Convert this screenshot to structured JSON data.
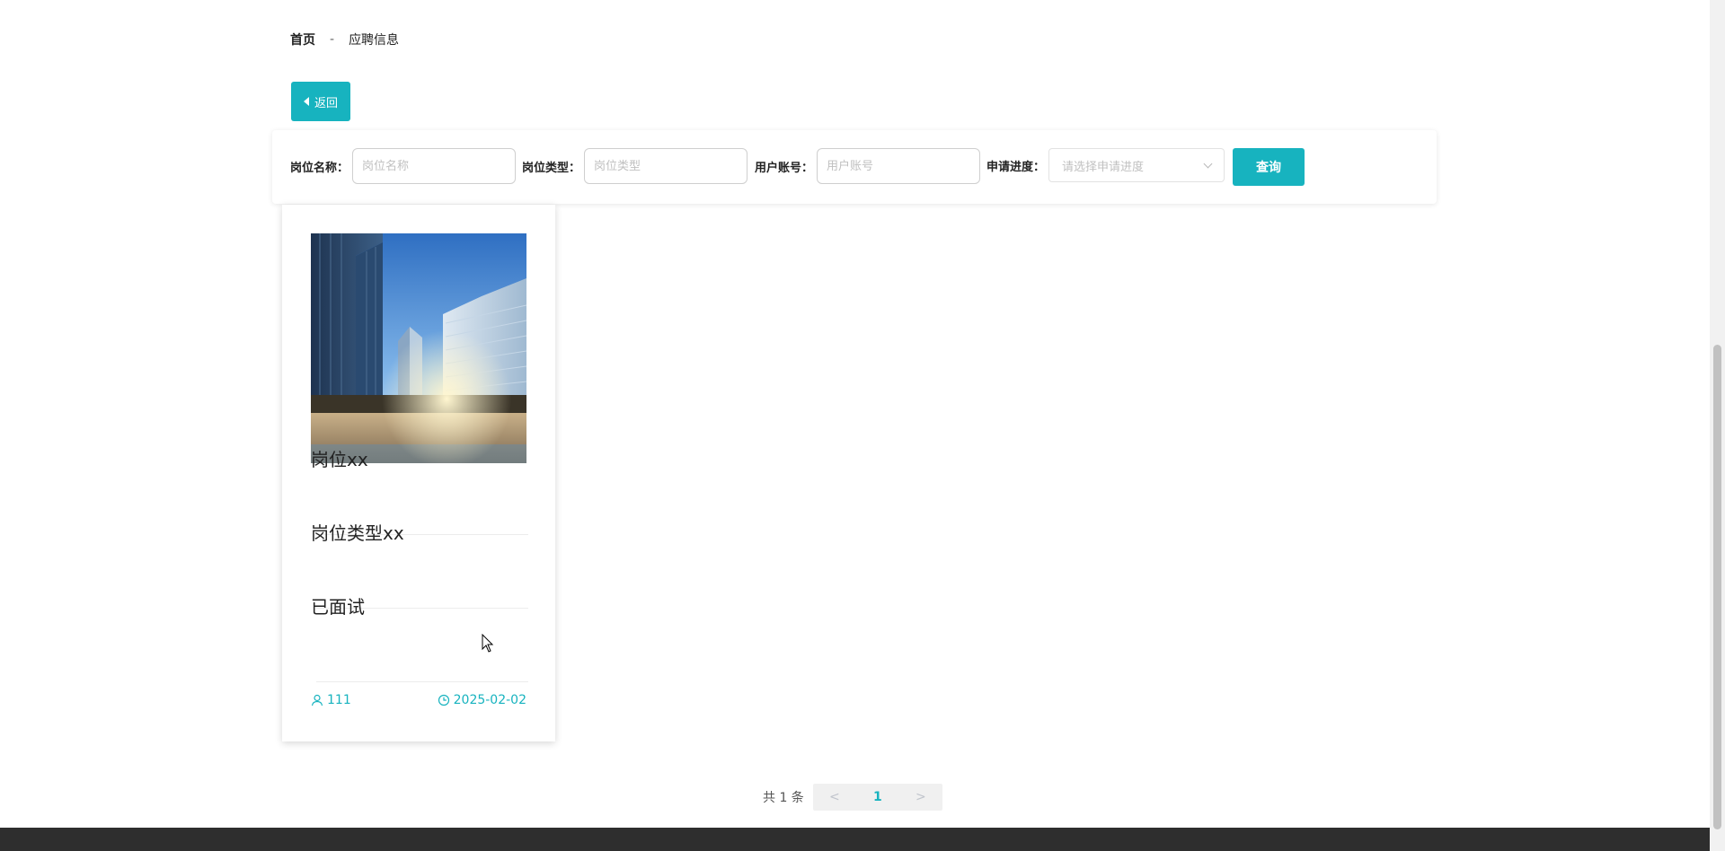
{
  "breadcrumb": {
    "home": "首页",
    "separator": "-",
    "current": "应聘信息"
  },
  "back_button": {
    "label": "返回"
  },
  "search": {
    "position_name_label": "岗位名称：",
    "position_name_placeholder": "岗位名称",
    "position_type_label": "岗位类型：",
    "position_type_placeholder": "岗位类型",
    "user_account_label": "用户账号：",
    "user_account_placeholder": "用户账号",
    "progress_label": "申请进度：",
    "progress_placeholder": "请选择申请进度",
    "query_label": "查询"
  },
  "cards": [
    {
      "title": "岗位xx",
      "type": "岗位类型xx",
      "status": "已面试",
      "user": "111",
      "date": "2025-02-02"
    }
  ],
  "pagination": {
    "total_text": "共 1 条",
    "prev": "<",
    "current_page": "1",
    "next": ">"
  },
  "colors": {
    "accent": "#17b3bf",
    "footer": "#2e2e2e"
  }
}
